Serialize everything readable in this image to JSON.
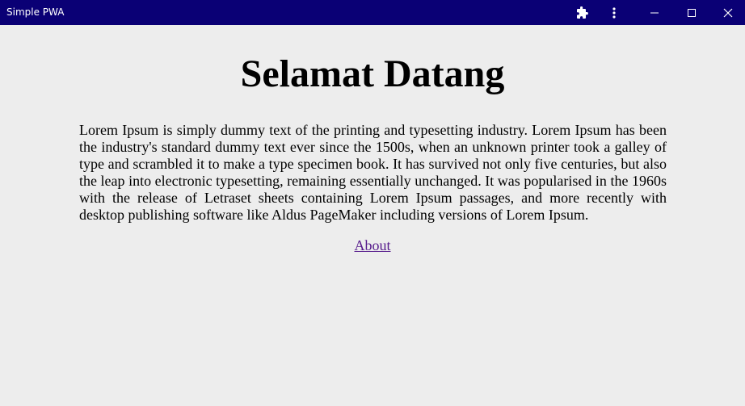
{
  "window": {
    "title": "Simple PWA",
    "icons": {
      "extensions": "puzzle-icon",
      "menu": "more-vert-icon",
      "minimize": "minimize-icon",
      "maximize": "maximize-icon",
      "close": "close-icon"
    },
    "titlebar_color": "#0a0075"
  },
  "page": {
    "heading": "Selamat Datang",
    "paragraph": "Lorem Ipsum is simply dummy text of the printing and typesetting industry. Lorem Ipsum has been the industry's standard dummy text ever since the 1500s, when an unknown printer took a galley of type and scrambled it to make a type specimen book. It has survived not only five centuries, but also the leap into electronic typesetting, remaining essentially unchanged. It was popularised in the 1960s with the release of Letraset sheets containing Lorem Ipsum passages, and more recently with desktop publishing software like Aldus PageMaker including versions of Lorem Ipsum.",
    "link_label": "About",
    "link_color": "#551a8b"
  }
}
